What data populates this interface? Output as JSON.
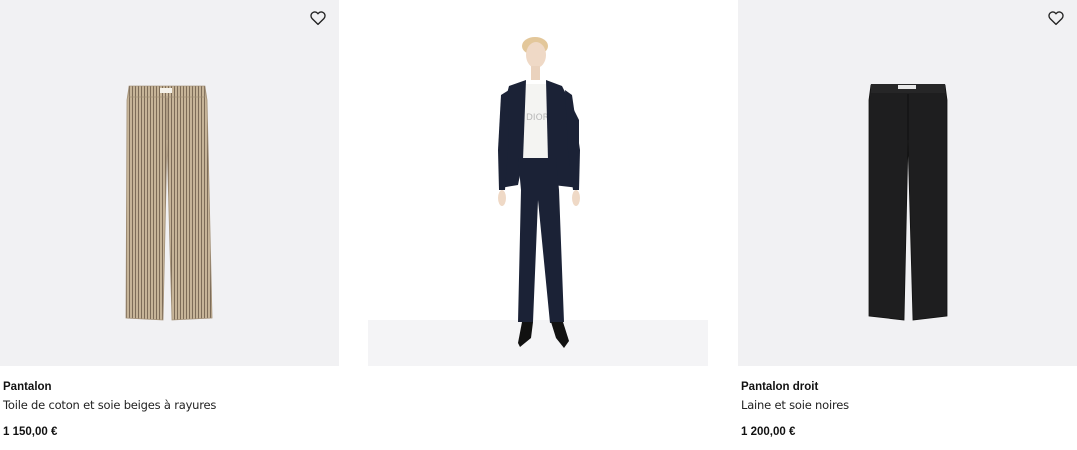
{
  "products": [
    {
      "name": "Pantalon",
      "description": "Toile de coton et soie beiges à rayures",
      "price": "1 150,00 €",
      "color": "#b9a68a"
    },
    {
      "type": "editorial-look",
      "label_printed": "DIOR"
    },
    {
      "name": "Pantalon droit",
      "description": "Laine et soie noires",
      "price": "1 200,00 €",
      "color": "#1e1e1f"
    }
  ],
  "icons": {
    "wishlist": "heart-outline-icon"
  }
}
